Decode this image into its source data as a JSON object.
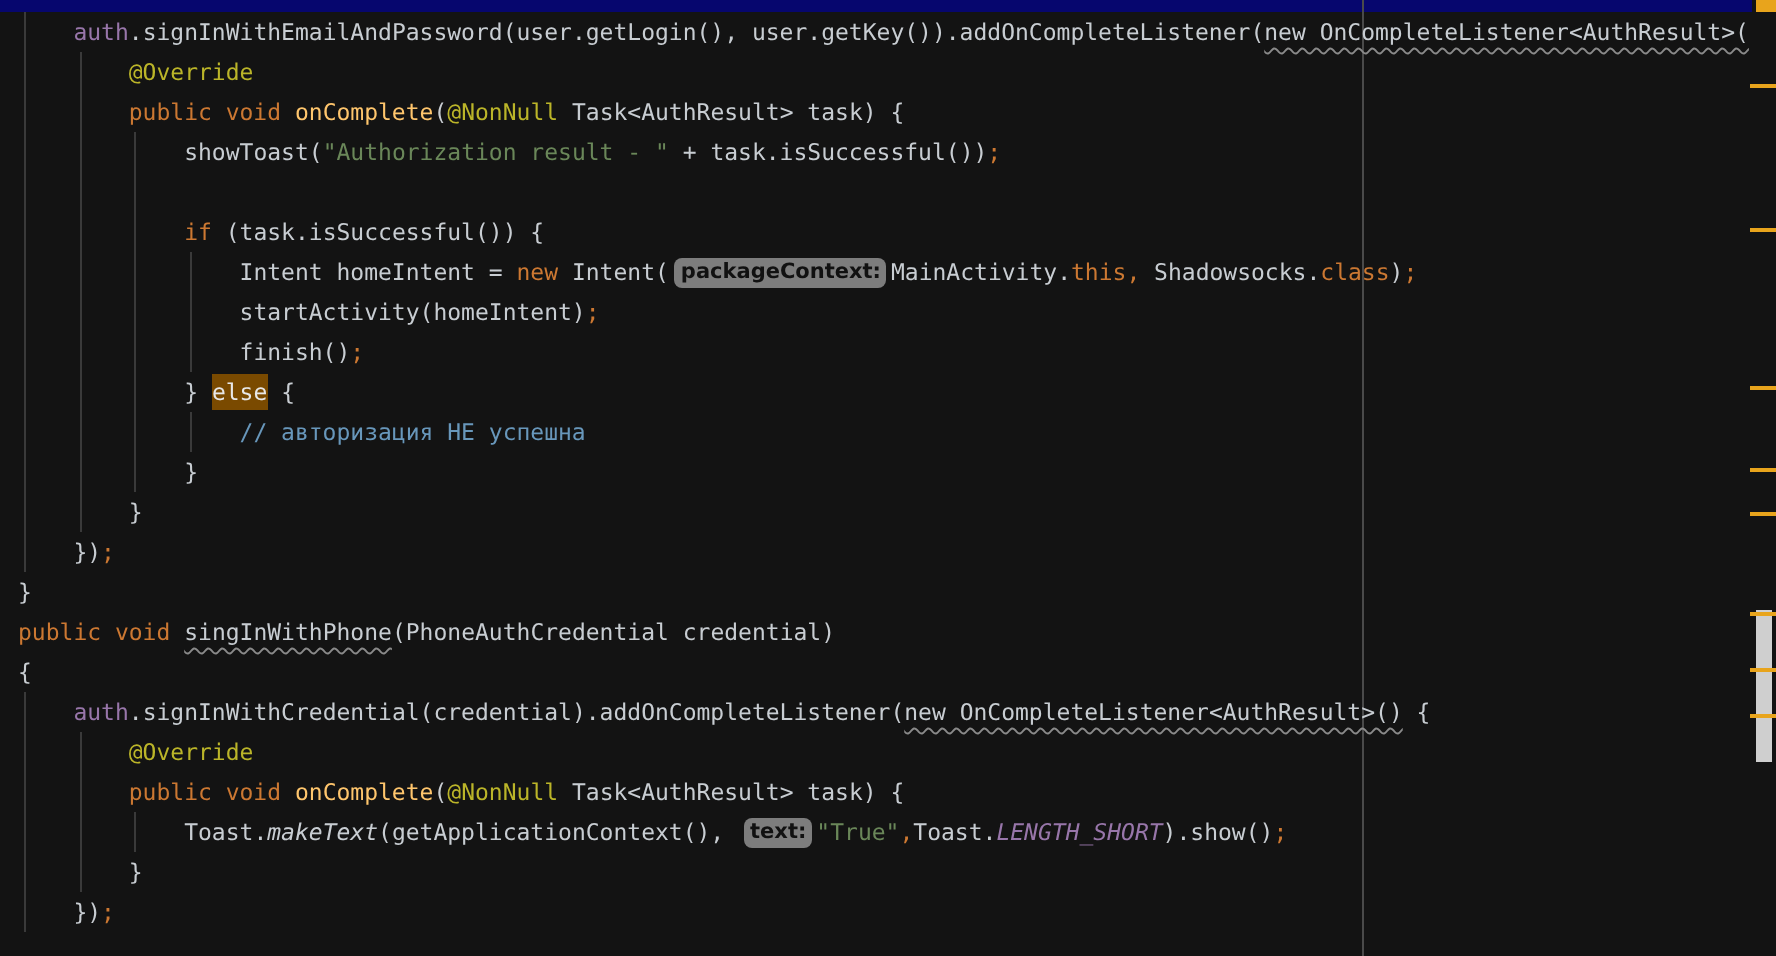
{
  "editor": {
    "lines": [
      {
        "kind": "group",
        "children": [
          {
            "kind": "code",
            "tokens": [
              {
                "text": "auth",
                "kind": "field"
              },
              {
                "text": ".signInWithEmailAndPassword(user.getLogin(), user.getKey()).addOnCompleteListener(",
                "kind": "plain"
              },
              {
                "text": "new OnCompleteListener<AuthResult>(",
                "kind": "warn"
              }
            ],
            "children": [
              {
                "kind": "code",
                "tokens": [
                  {
                    "text": "@Override",
                    "kind": "annotation"
                  }
                ]
              },
              {
                "kind": "code",
                "tokens": [
                  {
                    "text": "public void ",
                    "kind": "keyword"
                  },
                  {
                    "text": "onComplete",
                    "kind": "method"
                  },
                  {
                    "text": "(",
                    "kind": "plain"
                  },
                  {
                    "text": "@NonNull",
                    "kind": "annotation"
                  },
                  {
                    "text": " Task<AuthResult> task) {",
                    "kind": "plain"
                  }
                ],
                "children": [
                  {
                    "kind": "code",
                    "tokens": [
                      {
                        "text": "showToast(",
                        "kind": "plain"
                      },
                      {
                        "text": "\"Authorization result - \"",
                        "kind": "string"
                      },
                      {
                        "text": " + task.isSuccessful())",
                        "kind": "plain"
                      },
                      {
                        "text": ";",
                        "kind": "keyword"
                      }
                    ]
                  },
                  {
                    "kind": "blank"
                  },
                  {
                    "kind": "code",
                    "tokens": [
                      {
                        "text": "if",
                        "kind": "keyword"
                      },
                      {
                        "text": " (task.isSuccessful()) {",
                        "kind": "plain"
                      }
                    ],
                    "children": [
                      {
                        "kind": "code",
                        "tokens": [
                          {
                            "text": "Intent homeIntent = ",
                            "kind": "plain"
                          },
                          {
                            "text": "new",
                            "kind": "keyword"
                          },
                          {
                            "text": " Intent(",
                            "kind": "plain"
                          },
                          {
                            "text": "packageContext:",
                            "kind": "hint"
                          },
                          {
                            "text": "MainActivity.",
                            "kind": "plain"
                          },
                          {
                            "text": "this,",
                            "kind": "keyword"
                          },
                          {
                            "text": " Shadowsocks.",
                            "kind": "plain"
                          },
                          {
                            "text": "class",
                            "kind": "keyword"
                          },
                          {
                            "text": ")",
                            "kind": "plain"
                          },
                          {
                            "text": ";",
                            "kind": "keyword"
                          }
                        ]
                      },
                      {
                        "kind": "code",
                        "tokens": [
                          {
                            "text": "startActivity(homeIntent)",
                            "kind": "plain"
                          },
                          {
                            "text": ";",
                            "kind": "keyword"
                          }
                        ]
                      },
                      {
                        "kind": "code",
                        "tokens": [
                          {
                            "text": "finish()",
                            "kind": "plain"
                          },
                          {
                            "text": ";",
                            "kind": "keyword"
                          }
                        ]
                      }
                    ]
                  },
                  {
                    "kind": "code",
                    "tokens": [
                      {
                        "text": "} ",
                        "kind": "plain"
                      },
                      {
                        "text": "else",
                        "kind": "match"
                      },
                      {
                        "text": " {",
                        "kind": "plain"
                      }
                    ],
                    "children": [
                      {
                        "kind": "code",
                        "tokens": [
                          {
                            "text": "// авторизация НЕ успешна",
                            "kind": "comment"
                          }
                        ]
                      }
                    ]
                  },
                  {
                    "kind": "code",
                    "tokens": [
                      {
                        "text": "}",
                        "kind": "plain"
                      }
                    ]
                  }
                ]
              },
              {
                "kind": "code",
                "tokens": [
                  {
                    "text": "}",
                    "kind": "plain"
                  }
                ]
              }
            ]
          },
          {
            "kind": "code",
            "tokens": [
              {
                "text": "})",
                "kind": "plain"
              },
              {
                "text": ";",
                "kind": "keyword"
              }
            ]
          }
        ]
      },
      {
        "kind": "code",
        "tokens": [
          {
            "text": "}",
            "kind": "plain"
          }
        ]
      },
      {
        "kind": "code",
        "tokens": [
          {
            "text": "public void ",
            "kind": "keyword"
          },
          {
            "text": "singInWithPhone",
            "kind": "warn"
          },
          {
            "text": "(PhoneAuthCredential credential)",
            "kind": "plain"
          }
        ]
      },
      {
        "kind": "code",
        "tokens": [
          {
            "text": "{",
            "kind": "plain"
          }
        ],
        "children": [
          {
            "kind": "code",
            "tokens": [
              {
                "text": "auth",
                "kind": "field"
              },
              {
                "text": ".signInWithCredential(credential).addOnCompleteListener(",
                "kind": "plain"
              },
              {
                "text": "new OnCompleteListener<AuthResult>()",
                "kind": "warn"
              },
              {
                "text": " {",
                "kind": "plain"
              }
            ],
            "children": [
              {
                "kind": "code",
                "tokens": [
                  {
                    "text": "@Override",
                    "kind": "annotation"
                  }
                ]
              },
              {
                "kind": "code",
                "tokens": [
                  {
                    "text": "public void ",
                    "kind": "keyword"
                  },
                  {
                    "text": "onComplete",
                    "kind": "method"
                  },
                  {
                    "text": "(",
                    "kind": "plain"
                  },
                  {
                    "text": "@NonNull",
                    "kind": "annotation"
                  },
                  {
                    "text": " Task<AuthResult> task) {",
                    "kind": "plain"
                  }
                ],
                "children": [
                  {
                    "kind": "code",
                    "tokens": [
                      {
                        "text": "Toast.",
                        "kind": "plain"
                      },
                      {
                        "text": "makeText",
                        "kind": "static"
                      },
                      {
                        "text": "(getApplicationContext(), ",
                        "kind": "plain"
                      },
                      {
                        "text": "text:",
                        "kind": "hint"
                      },
                      {
                        "text": "\"True\"",
                        "kind": "string"
                      },
                      {
                        "text": ",",
                        "kind": "keyword"
                      },
                      {
                        "text": "Toast.",
                        "kind": "plain"
                      },
                      {
                        "text": "LENGTH_SHORT",
                        "kind": "constant"
                      },
                      {
                        "text": ").show()",
                        "kind": "plain"
                      },
                      {
                        "text": ";",
                        "kind": "keyword"
                      }
                    ]
                  }
                ]
              },
              {
                "kind": "code",
                "tokens": [
                  {
                    "text": "}",
                    "kind": "plain"
                  }
                ]
              }
            ]
          },
          {
            "kind": "code",
            "tokens": [
              {
                "text": "})",
                "kind": "plain"
              },
              {
                "text": ";",
                "kind": "keyword"
              }
            ]
          }
        ]
      }
    ]
  }
}
